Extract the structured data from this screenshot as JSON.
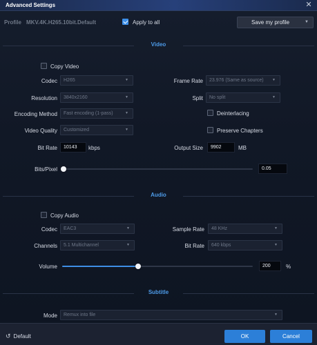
{
  "window": {
    "title": "Advanced Settings"
  },
  "profile": {
    "label": "Profile",
    "name": "MKV.4K.H265.10bit.Default"
  },
  "apply_all": {
    "label": "Apply to all",
    "checked": true
  },
  "save_profile": {
    "label": "Save my profile"
  },
  "sections": {
    "video": "Video",
    "audio": "Audio",
    "subtitle": "Subtitle"
  },
  "video": {
    "copy_video": {
      "label": "Copy Video",
      "checked": false
    },
    "codec": {
      "label": "Codec",
      "value": "H265"
    },
    "frame_rate": {
      "label": "Frame Rate",
      "value": "23.976 (Same as source)"
    },
    "resolution": {
      "label": "Resolution",
      "value": "3840x2160"
    },
    "split": {
      "label": "Split",
      "value": "No split"
    },
    "encoding_method": {
      "label": "Encoding Method",
      "value": "Fast encoding (1-pass)"
    },
    "deinterlacing": {
      "label": "Deinterlacing",
      "checked": false
    },
    "video_quality": {
      "label": "Video Quality",
      "value": "Customized"
    },
    "preserve_chapters": {
      "label": "Preserve Chapters",
      "checked": false
    },
    "bit_rate": {
      "label": "Bit Rate",
      "value": "10143",
      "unit": "kbps"
    },
    "output_size": {
      "label": "Output Size",
      "value": "9902",
      "unit": "MB"
    },
    "bits_pixel": {
      "label": "Bits/Pixel",
      "value": "0.05",
      "level": 0.0
    }
  },
  "audio": {
    "copy_audio": {
      "label": "Copy Audio",
      "checked": false
    },
    "codec": {
      "label": "Codec",
      "value": "EAC3"
    },
    "sample_rate": {
      "label": "Sample Rate",
      "value": "48 KHz"
    },
    "channels": {
      "label": "Channels",
      "value": "5.1 Multichannel"
    },
    "bit_rate": {
      "label": "Bit Rate",
      "value": "640 kbps"
    },
    "volume": {
      "label": "Volume",
      "value": "200",
      "unit": "%",
      "level": 0.4
    }
  },
  "subtitle": {
    "mode": {
      "label": "Mode",
      "value": "Remux into file"
    }
  },
  "footer": {
    "default_label": "Default",
    "ok_label": "OK",
    "cancel_label": "Cancel"
  },
  "icons": {
    "close": "close-icon",
    "dropdown": "chevron-down-icon",
    "reset": "reset-icon",
    "check": "checkmark-icon"
  },
  "colors": {
    "accent": "#3e8ee6",
    "button": "#2c7fd8",
    "section_title": "#4d9be8"
  }
}
